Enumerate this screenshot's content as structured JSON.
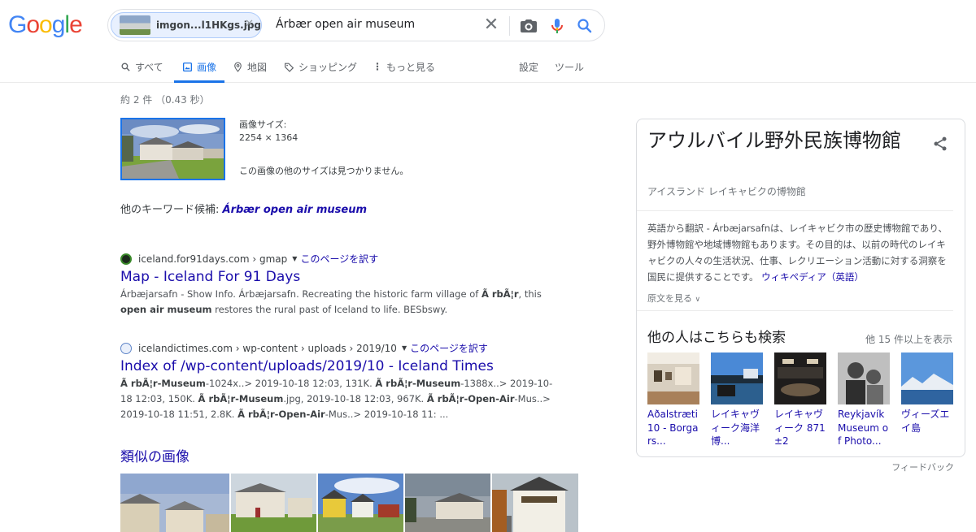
{
  "logo_text": "Google",
  "search": {
    "chip_filename": "imgon...l1HKgs.jpg",
    "query": "Árbær open air museum"
  },
  "tabs": [
    {
      "label": "すべて",
      "icon": "search-icon"
    },
    {
      "label": "画像",
      "icon": "image-icon",
      "active": true
    },
    {
      "label": "地図",
      "icon": "map-pin-icon"
    },
    {
      "label": "ショッピング",
      "icon": "tag-icon"
    },
    {
      "label": "もっと見る",
      "icon": "more-vert-icon"
    }
  ],
  "tools": {
    "settings": "設定",
    "tools": "ツール"
  },
  "stats": "約 2 件 （0.43 秒）",
  "image_info": {
    "size_label": "画像サイズ:",
    "size_value": "2254 × 1364",
    "no_other_sizes": "この画像の他のサイズは見つかりません。"
  },
  "keyword": {
    "label": "他のキーワード候補:",
    "link": "Árbær open air museum"
  },
  "results": [
    {
      "breadcrumb": "iceland.for91days.com › gmap",
      "translate": "このページを訳す",
      "title": "Map - Iceland For 91 Days",
      "snippet_1": "Árbæjarsafn - Show Info. Árbæjarsafn. Recreating the historic farm village of ",
      "snippet_b1": "Ã rbÃ¦r",
      "snippet_2": ", this ",
      "snippet_b2": "open air museum",
      "snippet_3": " restores the rural past of Iceland to life. BESbswy."
    },
    {
      "breadcrumb": "icelandictimes.com › wp-content › uploads › 2019/10",
      "translate": "このページを訳す",
      "title": "Index of /wp-content/uploads/2019/10 - Iceland Times",
      "p1b": "Ã rbÃ¦r-Museum",
      "p1": "-1024x..> 2019-10-18 12:03, 131K. ",
      "p2b": "Ã rbÃ¦r-Museum",
      "p2": "-1388x..> 2019-10-18 12:03, 150K. ",
      "p3b": "Ã rbÃ¦r-Museum",
      "p3": ".jpg, 2019-10-18 12:03, 967K. ",
      "p4b": "Ã rbÃ¦r-Open-Air",
      "p4": "-Mus..> 2019-10-18 11:51, 2.8K. ",
      "p5b": "Ã rbÃ¦r-Open-Air",
      "p5": "-Mus..> 2019-10-18 11: ..."
    }
  ],
  "similar_title": "類似の画像",
  "knowledge_panel": {
    "title": "アウルバイル野外民族博物館",
    "subtitle": "アイスランド レイキャビクの博物館",
    "desc": "英語から翻訳 - Árbæjarsafnは、レイキャビク市の歴史博物館であり、野外博物館や地域博物館もあります。その目的は、以前の時代のレイキャビクの人々の生活状況、仕事、レクリエーション活動に対する洞察を国民に提供することです。",
    "wiki_link": "ウィキペディア（英語）",
    "show_more": "原文を見る",
    "also_search": "他の人はこちらも検索",
    "also_more": "他 15 件以上を表示",
    "items": [
      {
        "label": "Aðalstræti 10 - Borgars..."
      },
      {
        "label": "レイキャヴィーク海洋博..."
      },
      {
        "label": "レイキャヴィーク 871±2"
      },
      {
        "label": "Reykjavík Museum of Photo..."
      },
      {
        "label": "ヴィーズエイ島"
      }
    ]
  },
  "feedback": "フィードバック",
  "colors": {
    "link": "#1a0dab",
    "accent": "#1a73e8",
    "blue": "#4285f4",
    "red": "#ea4335",
    "yellow": "#fbbc05",
    "green": "#34a853"
  }
}
